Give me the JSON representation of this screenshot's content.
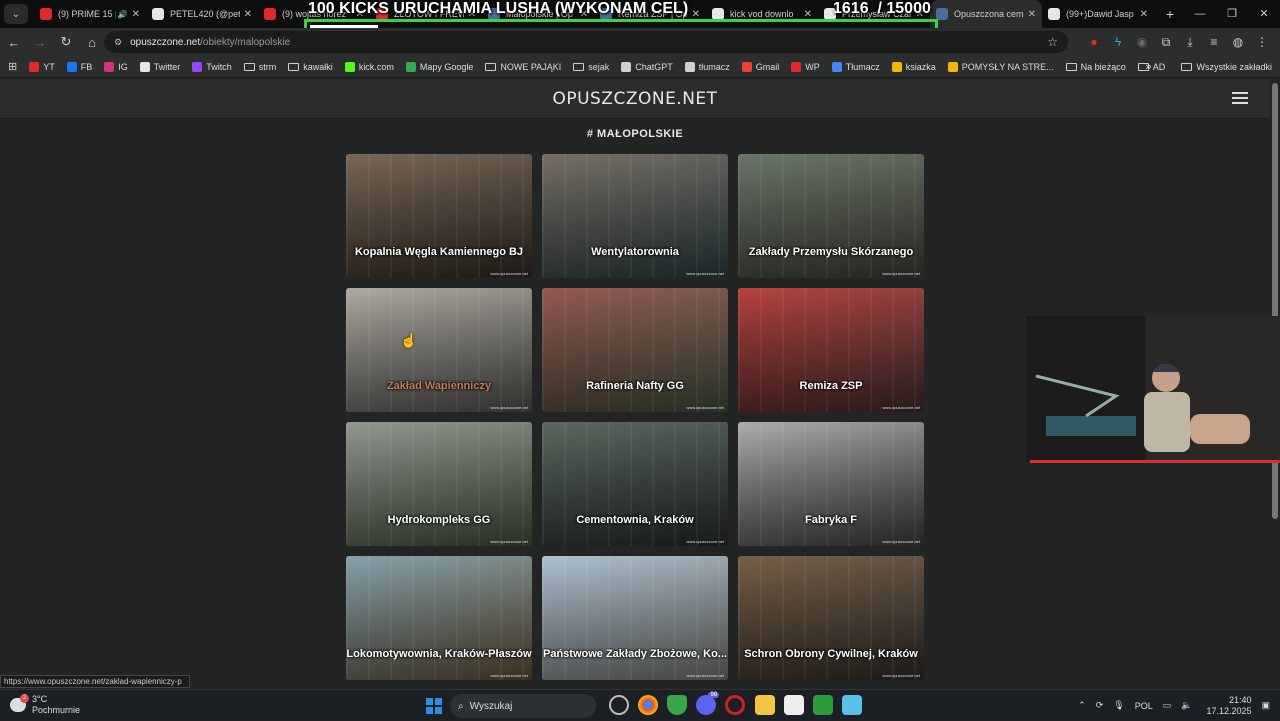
{
  "tabs": [
    {
      "title": "(9) PRIME 15 |",
      "icon_color": "#e22a2a",
      "active": false,
      "audio": true
    },
    {
      "title": "PETEL420 (@pete",
      "icon_color": "#e6e6e6",
      "active": false,
      "audio": false
    },
    {
      "title": "(9) wojtas norez",
      "icon_color": "#e22a2a",
      "active": false,
      "audio": false
    },
    {
      "title": "ZŁOTOW I FREWE",
      "icon_color": "#e22a2a",
      "active": false,
      "audio": false
    },
    {
      "title": "Małopolskie | Op",
      "icon_color": "#4a6d9c",
      "active": false,
      "audio": false
    },
    {
      "title": "Remiza ZSP | Op",
      "icon_color": "#4a6d9c",
      "active": false,
      "audio": false
    },
    {
      "title": "kick vod downlo",
      "icon_color": "#e6e6e6",
      "active": false,
      "audio": false
    },
    {
      "title": "Przemysław Czar",
      "icon_color": "#e6e6e6",
      "active": false,
      "audio": false
    },
    {
      "title": "Opuszczona ceme",
      "icon_color": "#4a6d9c",
      "active": true,
      "audio": false
    },
    {
      "title": "(99+)Dawid Jasp",
      "icon_color": "#e6e6e6",
      "active": false,
      "audio": false
    }
  ],
  "overlay": {
    "title": "100 KICKS URUCHAMIA LUSHA (WYKONAM CEL)",
    "count": "1616",
    "goal": "/ 15000",
    "progress": 0.108
  },
  "address": {
    "host": "opuszczone.net",
    "path": "/obiekty/malopolskie"
  },
  "bookmarks": [
    {
      "label": "YT",
      "kind": "icon",
      "color": "#e22a2a"
    },
    {
      "label": "FB",
      "kind": "icon",
      "color": "#1877f2"
    },
    {
      "label": "IG",
      "kind": "icon",
      "color": "#d6307a"
    },
    {
      "label": "Twitter",
      "kind": "icon",
      "color": "#e6e6e6"
    },
    {
      "label": "Twitch",
      "kind": "icon",
      "color": "#9146ff"
    },
    {
      "label": "strm",
      "kind": "folder",
      "color": ""
    },
    {
      "label": "kawałki",
      "kind": "folder",
      "color": ""
    },
    {
      "label": "kick.com",
      "kind": "icon",
      "color": "#53fc18"
    },
    {
      "label": "Mapy Google",
      "kind": "icon",
      "color": "#34a853"
    },
    {
      "label": "NOWE PAJĄKI",
      "kind": "folder",
      "color": ""
    },
    {
      "label": "sejak",
      "kind": "folder",
      "color": ""
    },
    {
      "label": "ChatGPT",
      "kind": "icon",
      "color": "#cfcfcf"
    },
    {
      "label": "tłumacz",
      "kind": "icon",
      "color": "#cfcfcf"
    },
    {
      "label": "Gmail",
      "kind": "icon",
      "color": "#ea4335"
    },
    {
      "label": "WP",
      "kind": "icon",
      "color": "#e22a2a"
    },
    {
      "label": "Tłumacz",
      "kind": "icon",
      "color": "#4285f4"
    },
    {
      "label": "ksiazka",
      "kind": "icon",
      "color": "#f4b400"
    },
    {
      "label": "POMYSŁY NA STRE...",
      "kind": "icon",
      "color": "#f4b400"
    },
    {
      "label": "Na bieżąco",
      "kind": "folder",
      "color": ""
    },
    {
      "label": "AD",
      "kind": "folder",
      "color": ""
    }
  ],
  "bookmarks_right": "Wszystkie zakładki",
  "site": {
    "logo": "OPUSZCZONE.NET",
    "heading": "# MAŁOPOLSKIE",
    "watermark": "www.opuszczone.net"
  },
  "cards": [
    {
      "label": "Kopalnia Węgla Kamiennego BJ",
      "bg1": "#6d5a48",
      "bg2": "#2e2822",
      "hover": false
    },
    {
      "label": "Wentylatorownia",
      "bg1": "#6b6257",
      "bg2": "#2a3a3e",
      "hover": false
    },
    {
      "label": "Zakłady Przemysłu Skórzanego",
      "bg1": "#5e6a5c",
      "bg2": "#3a3a32",
      "hover": false
    },
    {
      "label": "Zakład Wapienniczy",
      "bg1": "#a8a49c",
      "bg2": "#4c4a46",
      "hover": true
    },
    {
      "label": "Rafineria Nafty GG",
      "bg1": "#8c4a44",
      "bg2": "#3b4a36",
      "hover": false
    },
    {
      "label": "Remiza ZSP",
      "bg1": "#b2322e",
      "bg2": "#3c2a2a",
      "hover": false
    },
    {
      "label": "Hydrokompleks GG",
      "bg1": "#8a9088",
      "bg2": "#3e4a38",
      "hover": false
    },
    {
      "label": "Cementownia, Kraków",
      "bg1": "#4f5b52",
      "bg2": "#232927",
      "hover": false
    },
    {
      "label": "Fabryka F",
      "bg1": "#a4a8a2",
      "bg2": "#37383a",
      "hover": false
    },
    {
      "label": "Lokomotywownia, Kraków-Płaszów",
      "bg1": "#7c9aa6",
      "bg2": "#5a4a30",
      "hover": false
    },
    {
      "label": "Państwowe Zakłady Zbożowe, Ko...",
      "bg1": "#a7bccd",
      "bg2": "#6c6c68",
      "hover": false
    },
    {
      "label": "Schron Obrony Cywilnej, Kraków",
      "bg1": "#6c5238",
      "bg2": "#2c2a26",
      "hover": false
    }
  ],
  "status_url": "https://www.opuszczone.net/zaklad-wapienniczy-p",
  "taskbar": {
    "weather_badge": "2",
    "temp": "3°C",
    "condition": "Pochmurnie",
    "search_placeholder": "Wyszukaj",
    "lang": "POL",
    "time": "21:40",
    "date": "17.12.2025",
    "discord_badge": "99"
  }
}
